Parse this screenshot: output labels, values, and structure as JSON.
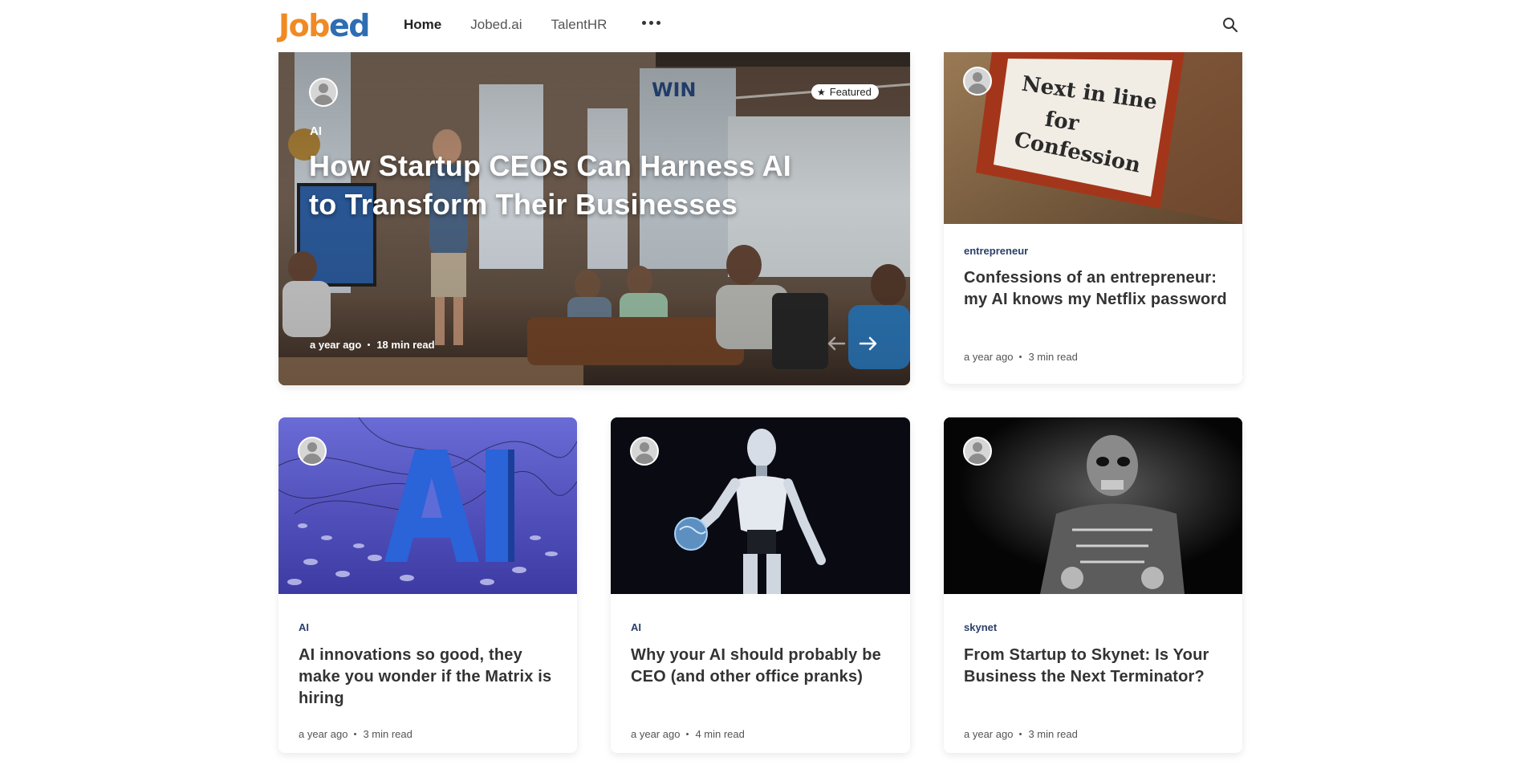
{
  "header": {
    "logo_part1": "Job",
    "logo_part2": "ed",
    "nav": [
      "Home",
      "Jobed.ai",
      "TalentHR"
    ],
    "more_icon": "more-dots-icon",
    "search_icon": "search-icon"
  },
  "featured": {
    "badge": "Featured",
    "badge_icon": "star-icon",
    "tag": "AI",
    "title": "How Startup CEOs Can Harness AI to Transform Their Businesses",
    "date": "a year ago",
    "read_time": "18 min read",
    "prev_icon": "arrow-left-icon",
    "next_icon": "arrow-right-icon"
  },
  "cards": [
    {
      "tag": "entrepreneur",
      "title": "Confessions of an entrepreneur: my AI knows my Netflix password",
      "date": "a year ago",
      "read_time": "3 min read",
      "image": "next-in-line-for-confession-sign"
    },
    {
      "tag": "AI",
      "title": "AI innovations so good, they make you wonder if the Matrix is hiring",
      "date": "a year ago",
      "read_time": "3 min read",
      "image": "blue-3d-ai-letters"
    },
    {
      "tag": "AI",
      "title": "Why your AI should probably be CEO (and other office pranks)",
      "date": "a year ago",
      "read_time": "4 min read",
      "image": "humanoid-robot-holding-brain"
    },
    {
      "tag": "skynet",
      "title": "From Startup to Skynet: Is Your Business the Next Terminator?",
      "date": "a year ago",
      "read_time": "3 min read",
      "image": "terminator-endoskeleton"
    }
  ],
  "colors": {
    "logo_orange": "#f08a24",
    "logo_blue": "#2f6db3",
    "tag_color": "#2a3f6a"
  }
}
